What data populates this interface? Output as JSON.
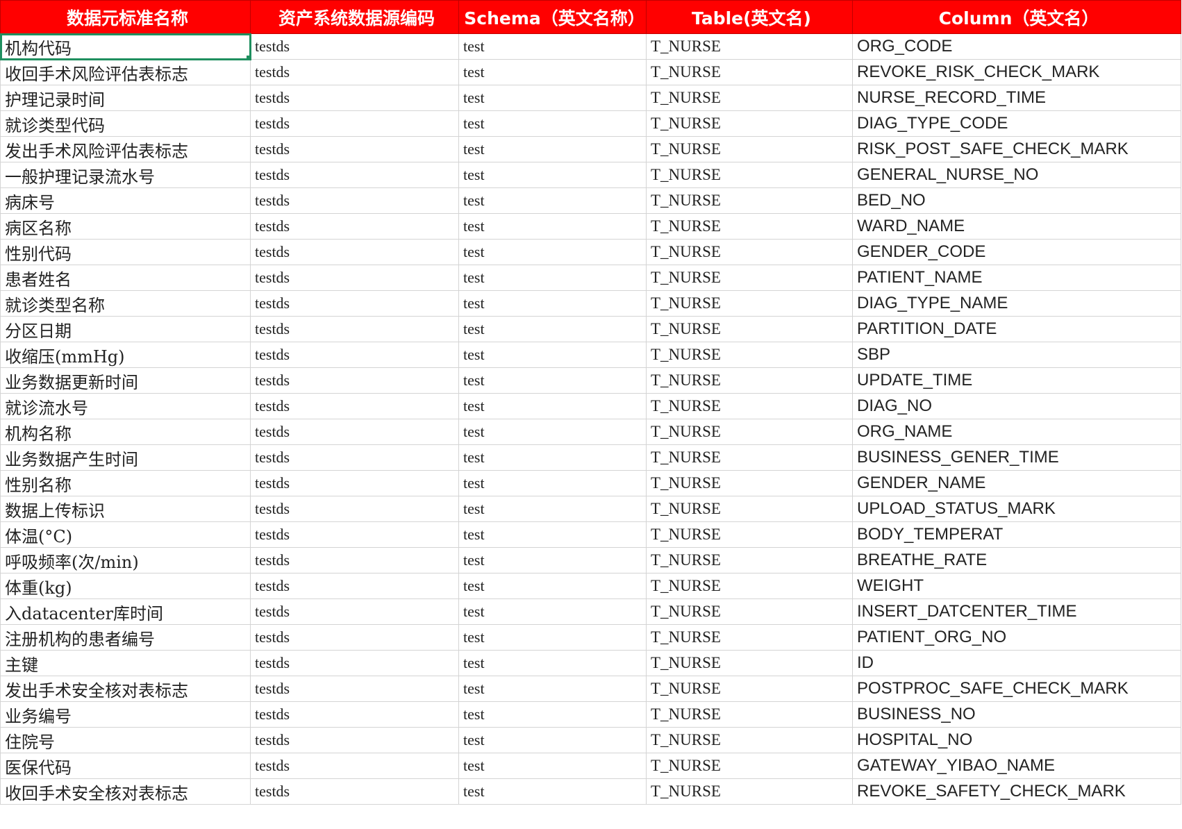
{
  "headers": [
    "数据元标准名称",
    "资产系统数据源编码",
    "Schema（英文名称）",
    "Table(英文名)",
    "Column（英文名）"
  ],
  "rows": [
    [
      "机构代码",
      "testds",
      "test",
      "T_NURSE",
      "ORG_CODE"
    ],
    [
      "收回手术风险评估表标志",
      "testds",
      "test",
      "T_NURSE",
      "REVOKE_RISK_CHECK_MARK"
    ],
    [
      "护理记录时间",
      "testds",
      "test",
      "T_NURSE",
      "NURSE_RECORD_TIME"
    ],
    [
      "就诊类型代码",
      "testds",
      "test",
      "T_NURSE",
      "DIAG_TYPE_CODE"
    ],
    [
      "发出手术风险评估表标志",
      "testds",
      "test",
      "T_NURSE",
      "RISK_POST_SAFE_CHECK_MARK"
    ],
    [
      "一般护理记录流水号",
      "testds",
      "test",
      "T_NURSE",
      "GENERAL_NURSE_NO"
    ],
    [
      "病床号",
      "testds",
      "test",
      "T_NURSE",
      "BED_NO"
    ],
    [
      "病区名称",
      "testds",
      "test",
      "T_NURSE",
      "WARD_NAME"
    ],
    [
      "性别代码",
      "testds",
      "test",
      "T_NURSE",
      "GENDER_CODE"
    ],
    [
      "患者姓名",
      "testds",
      "test",
      "T_NURSE",
      "PATIENT_NAME"
    ],
    [
      "就诊类型名称",
      "testds",
      "test",
      "T_NURSE",
      "DIAG_TYPE_NAME"
    ],
    [
      "分区日期",
      "testds",
      "test",
      "T_NURSE",
      "PARTITION_DATE"
    ],
    [
      "收缩压(mmHg)",
      "testds",
      "test",
      "T_NURSE",
      "SBP"
    ],
    [
      "业务数据更新时间",
      "testds",
      "test",
      "T_NURSE",
      "UPDATE_TIME"
    ],
    [
      "就诊流水号",
      "testds",
      "test",
      "T_NURSE",
      "DIAG_NO"
    ],
    [
      "机构名称",
      "testds",
      "test",
      "T_NURSE",
      "ORG_NAME"
    ],
    [
      "业务数据产生时间",
      "testds",
      "test",
      "T_NURSE",
      "BUSINESS_GENER_TIME"
    ],
    [
      "性别名称",
      "testds",
      "test",
      "T_NURSE",
      "GENDER_NAME"
    ],
    [
      "数据上传标识",
      "testds",
      "test",
      "T_NURSE",
      "UPLOAD_STATUS_MARK"
    ],
    [
      "体温(°C)",
      "testds",
      "test",
      "T_NURSE",
      "BODY_TEMPERAT"
    ],
    [
      "呼吸频率(次/min)",
      "testds",
      "test",
      "T_NURSE",
      "BREATHE_RATE"
    ],
    [
      "体重(kg)",
      "testds",
      "test",
      "T_NURSE",
      "WEIGHT"
    ],
    [
      "入datacenter库时间",
      "testds",
      "test",
      "T_NURSE",
      "INSERT_DATCENTER_TIME"
    ],
    [
      "注册机构的患者编号",
      "testds",
      "test",
      "T_NURSE",
      "PATIENT_ORG_NO"
    ],
    [
      "主键",
      "testds",
      "test",
      "T_NURSE",
      "ID"
    ],
    [
      "发出手术安全核对表标志",
      "testds",
      "test",
      "T_NURSE",
      "POSTPROC_SAFE_CHECK_MARK"
    ],
    [
      "业务编号",
      "testds",
      "test",
      "T_NURSE",
      "BUSINESS_NO"
    ],
    [
      "住院号",
      "testds",
      "test",
      "T_NURSE",
      "HOSPITAL_NO"
    ],
    [
      "医保代码",
      "testds",
      "test",
      "T_NURSE",
      "GATEWAY_YIBAO_NAME"
    ],
    [
      "收回手术安全核对表标志",
      "testds",
      "test",
      "T_NURSE",
      "REVOKE_SAFETY_CHECK_MARK"
    ]
  ],
  "selected_cell": {
    "row": 0,
    "col": 0
  },
  "colors": {
    "header_bg": "#ff0000",
    "header_text": "#ffffff",
    "selection": "#1f8f5f",
    "grid": "#d4d4d4"
  }
}
